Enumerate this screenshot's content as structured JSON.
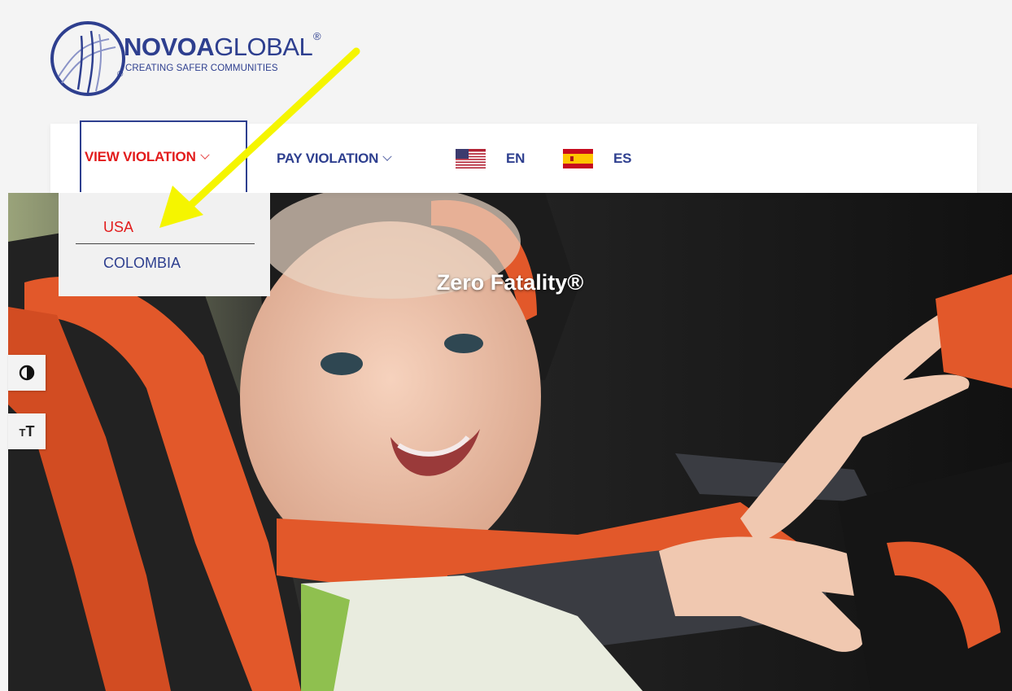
{
  "logo": {
    "brand_bold": "NOVOA",
    "brand_light": "GLOBAL",
    "registered": "®",
    "tagline": "CREATING SAFER COMMUNITIES",
    "registered_small": "®"
  },
  "nav": {
    "view_violation": "VIEW VIOLATION",
    "pay_violation": "PAY VIOLATION",
    "lang_en": "EN",
    "lang_es": "ES"
  },
  "dropdown": {
    "items": [
      {
        "label": "USA"
      },
      {
        "label": "COLOMBIA"
      }
    ]
  },
  "hero": {
    "title": "Zero Fatality®"
  },
  "accessibility": {
    "contrast_icon": "contrast-icon",
    "text_size_label": "TT",
    "text_size_icon": "text-size-icon"
  },
  "colors": {
    "brand_blue": "#2e3f8f",
    "active_red": "#e21b1b",
    "annotation_yellow": "#f5f500"
  }
}
